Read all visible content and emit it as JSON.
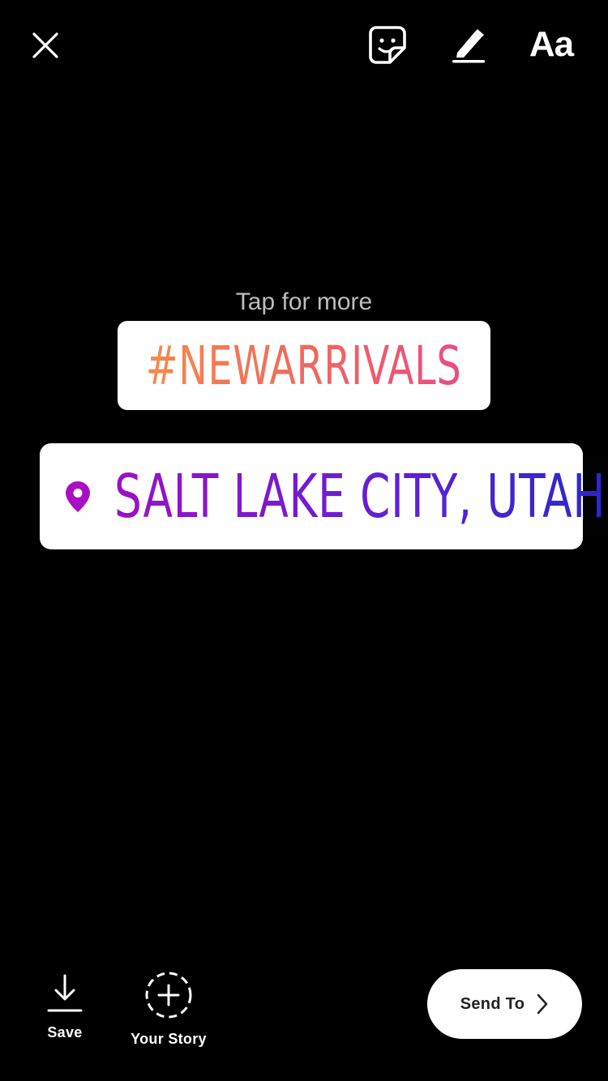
{
  "top_bar": {
    "close_icon": "close-icon",
    "sticker_icon": "sticker-icon",
    "draw_icon": "marker-icon",
    "text_tool_label": "Aa"
  },
  "canvas": {
    "hint": "Tap for more",
    "hashtag_sticker": {
      "text": "#NEWARRIVALS",
      "gradient": [
        "#f58a4b",
        "#f0655f",
        "#e94c86"
      ]
    },
    "location_sticker": {
      "text": "SALT LAKE CITY, UTAH",
      "icon": "location-pin-icon",
      "gradient": [
        "#9a12c4",
        "#6a1fd0",
        "#2a27cf"
      ]
    }
  },
  "bottom_bar": {
    "save": {
      "label": "Save",
      "icon": "download-icon"
    },
    "your_story": {
      "label": "Your Story",
      "icon": "add-story-icon"
    },
    "send_to": {
      "label": "Send To",
      "icon": "chevron-right-icon"
    }
  },
  "colors": {
    "background": "#000000",
    "hint_text": "#bdbdbd",
    "sticker_bg": "#ffffff"
  }
}
